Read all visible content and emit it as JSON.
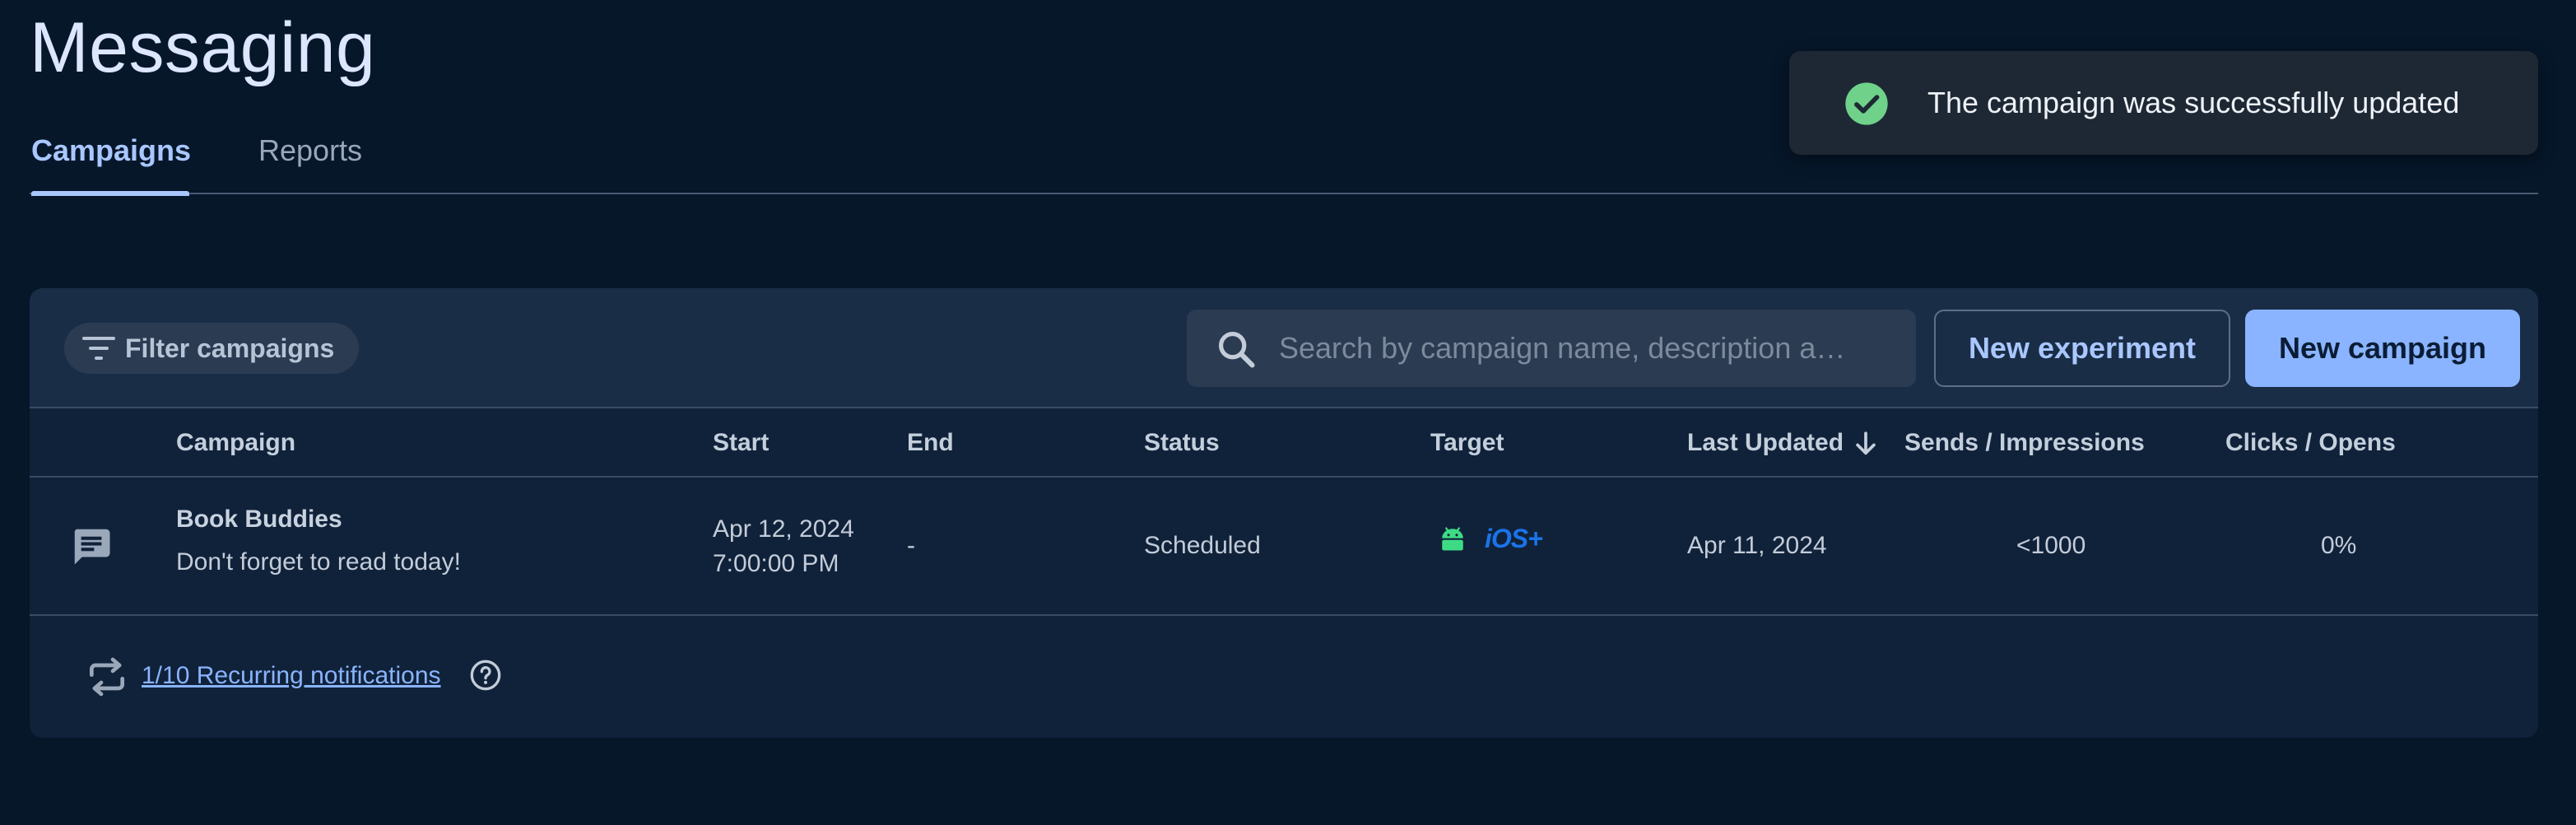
{
  "page": {
    "title": "Messaging"
  },
  "tabs": [
    {
      "label": "Campaigns",
      "active": true
    },
    {
      "label": "Reports",
      "active": false
    }
  ],
  "toast": {
    "message": "The campaign was successfully updated",
    "icon": "check-circle-icon",
    "color": "#6fd18a"
  },
  "toolbar": {
    "filter_label": "Filter campaigns",
    "search_placeholder": "Search by campaign name, description a…",
    "new_experiment_label": "New experiment",
    "new_campaign_label": "New campaign"
  },
  "table": {
    "columns": [
      "Campaign",
      "Start",
      "End",
      "Status",
      "Target",
      "Last Updated",
      "Sends / Impressions",
      "Clicks / Opens"
    ],
    "sort_column": "Last Updated",
    "sort_direction": "descending",
    "rows": [
      {
        "icon": "message-icon",
        "name": "Book Buddies",
        "description": "Don't forget to read today!",
        "start_date": "Apr 12, 2024",
        "start_time": "7:00:00 PM",
        "end": "-",
        "status": "Scheduled",
        "target": [
          "android-icon",
          "iOS+"
        ],
        "last_updated": "Apr 11, 2024",
        "sends": "<1000",
        "clicks": "0%"
      }
    ]
  },
  "footer": {
    "recurring_label": "1/10 Recurring notifications"
  },
  "colors": {
    "background": "#06172a",
    "accent": "#8ab4ff",
    "android": "#3ddc84",
    "ios": "#1a73e8"
  }
}
